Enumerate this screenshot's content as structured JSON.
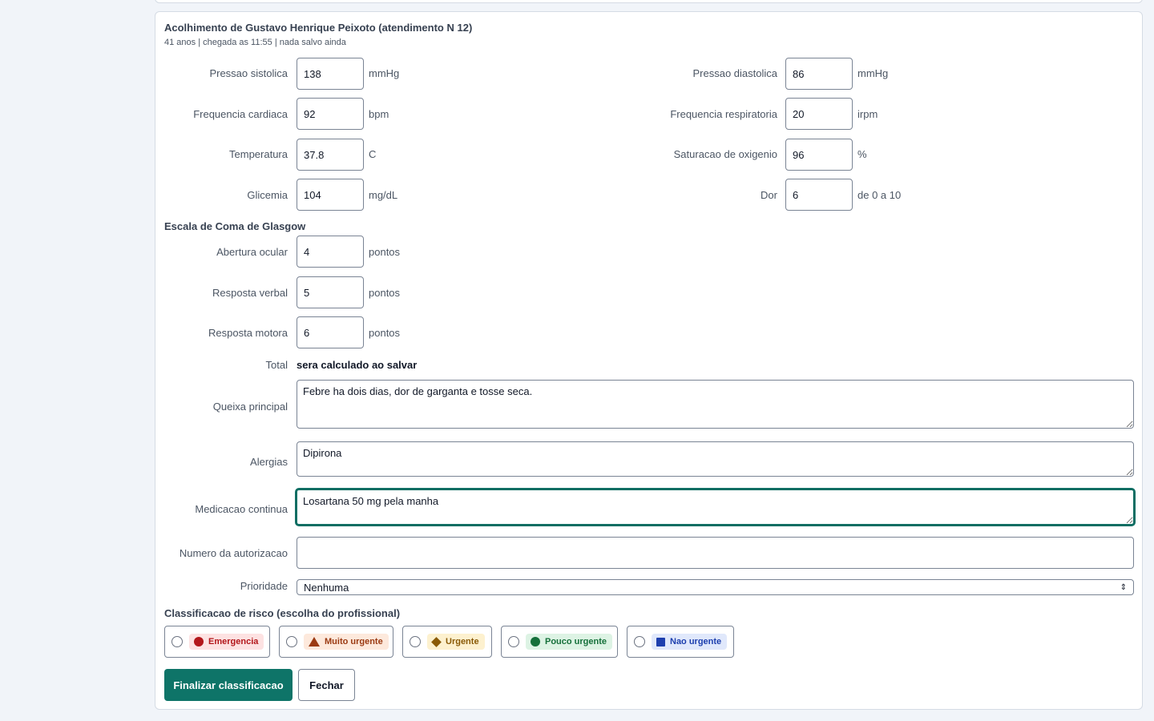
{
  "header": {
    "title": "Acolhimento de Gustavo Henrique Peixoto (atendimento N 12)",
    "subtitle": "41 anos | chegada as 11:55 | nada salvo ainda"
  },
  "vitals": {
    "sistolica": {
      "label": "Pressao sistolica",
      "value": "138",
      "unit": "mmHg"
    },
    "diastolica": {
      "label": "Pressao diastolica",
      "value": "86",
      "unit": "mmHg"
    },
    "fc": {
      "label": "Frequencia cardiaca",
      "value": "92",
      "unit": "bpm"
    },
    "fr": {
      "label": "Frequencia respiratoria",
      "value": "20",
      "unit": "irpm"
    },
    "temp": {
      "label": "Temperatura",
      "value": "37.8",
      "unit": "C"
    },
    "sat": {
      "label": "Saturacao de oxigenio",
      "value": "96",
      "unit": "%"
    },
    "glicemia": {
      "label": "Glicemia",
      "value": "104",
      "unit": "mg/dL"
    },
    "dor": {
      "label": "Dor",
      "value": "6",
      "unit": "de 0 a 10"
    }
  },
  "glasgow": {
    "heading": "Escala de Coma de Glasgow",
    "ocular": {
      "label": "Abertura ocular",
      "value": "4",
      "unit": "pontos"
    },
    "verbal": {
      "label": "Resposta verbal",
      "value": "5",
      "unit": "pontos"
    },
    "motora": {
      "label": "Resposta motora",
      "value": "6",
      "unit": "pontos"
    },
    "total_label": "Total",
    "total_value": "sera calculado ao salvar"
  },
  "fields": {
    "queixa": {
      "label": "Queixa principal",
      "value": "Febre ha dois dias, dor de garganta e tosse seca."
    },
    "alergias": {
      "label": "Alergias",
      "value": "Dipirona"
    },
    "medicacao": {
      "label": "Medicacao continua",
      "value": "Losartana 50 mg pela manha"
    },
    "autorizacao": {
      "label": "Numero da autorizacao",
      "value": ""
    },
    "prioridade": {
      "label": "Prioridade",
      "value": "Nenhuma"
    }
  },
  "risk": {
    "heading": "Classificacao de risco (escolha do profissional)",
    "options": [
      {
        "label": "Emergencia",
        "color": "#b3171b",
        "bg": "#fde2e2",
        "text": "#b3171b",
        "icon": "circle-icon"
      },
      {
        "label": "Muito urgente",
        "color": "#9b3a12",
        "bg": "#fde9dc",
        "text": "#9b3a12",
        "icon": "triangle-icon"
      },
      {
        "label": "Urgente",
        "color": "#8a5a06",
        "bg": "#fdf1cf",
        "text": "#8a5a06",
        "icon": "diamond-icon"
      },
      {
        "label": "Pouco urgente",
        "color": "#15703a",
        "bg": "#ddf3e4",
        "text": "#15703a",
        "icon": "circle-icon"
      },
      {
        "label": "Nao urgente",
        "color": "#1d3fae",
        "bg": "#e0e8fb",
        "text": "#1d3fae",
        "icon": "square-icon"
      }
    ]
  },
  "actions": {
    "finalizar": "Finalizar classificacao",
    "fechar": "Fechar"
  },
  "colors": {
    "accent": "#0e7468",
    "focus": "#0e6e63"
  }
}
